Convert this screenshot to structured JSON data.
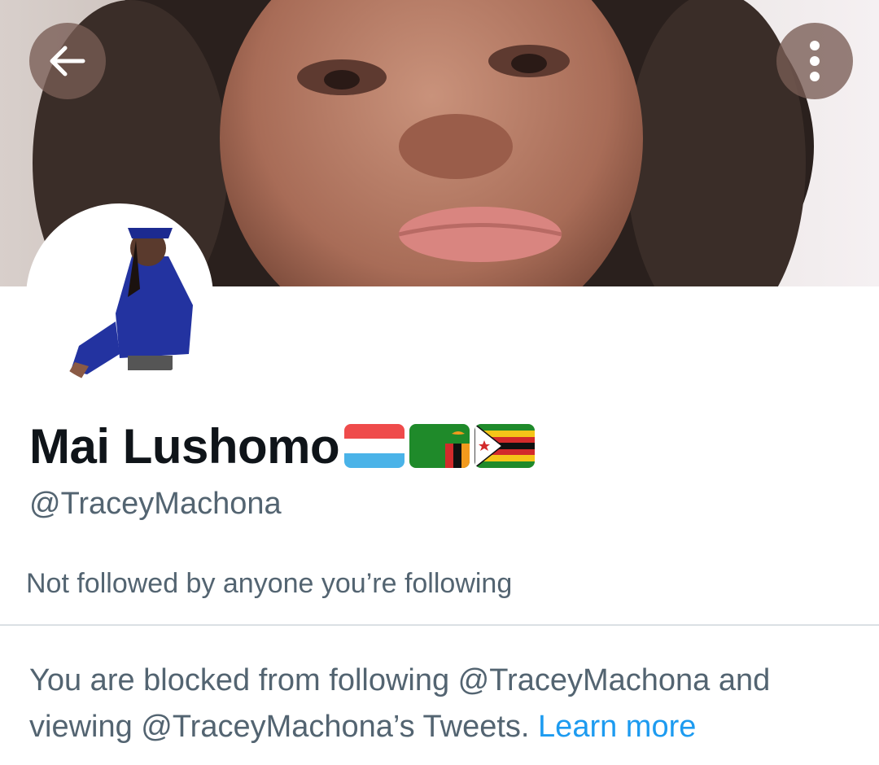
{
  "header": {
    "back_icon": "arrow-left-icon",
    "more_icon": "vertical-ellipsis-icon"
  },
  "profile": {
    "display_name": "Mai Lushomo",
    "flags": [
      "luxembourg-flag",
      "zambia-flag",
      "zimbabwe-flag"
    ],
    "handle": "@TraceyMachona",
    "followed_by_text": "Not followed by anyone you’re following"
  },
  "notice": {
    "text": "You are blocked from following @TraceyMachona and viewing @TraceyMachona’s Tweets.",
    "link_label": "Learn more"
  },
  "colors": {
    "primary_text": "#0f1419",
    "secondary_text": "#536471",
    "link": "#1d9bf0",
    "divider": "#dbe0e4"
  }
}
